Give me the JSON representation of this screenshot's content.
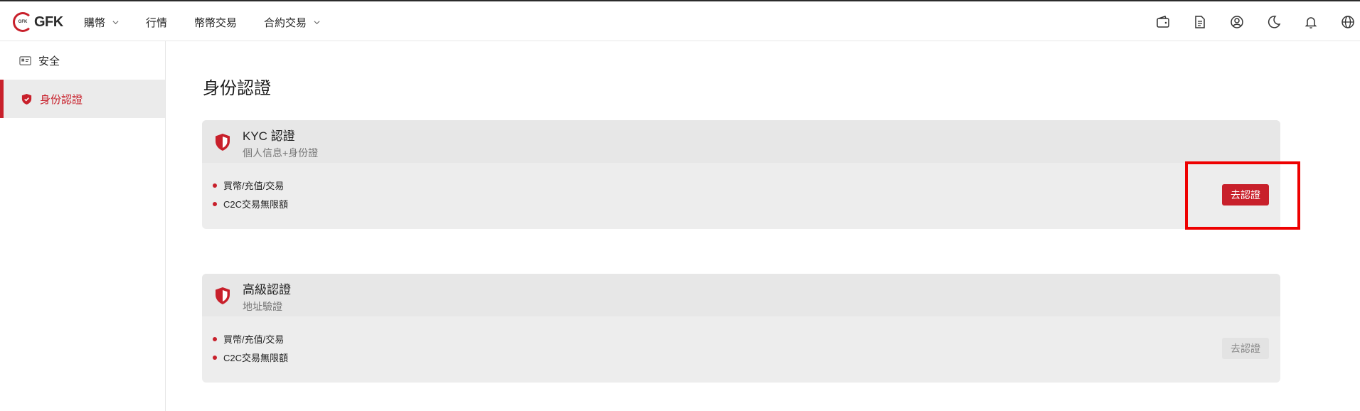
{
  "header": {
    "logo_text": "GFK",
    "logo_mark": "GFK",
    "nav": [
      {
        "label": "購幣",
        "has_dropdown": true
      },
      {
        "label": "行情",
        "has_dropdown": false
      },
      {
        "label": "幣幣交易",
        "has_dropdown": false
      },
      {
        "label": "合約交易",
        "has_dropdown": true
      }
    ],
    "tools": [
      "wallet-icon",
      "document-icon",
      "user-icon",
      "moon-icon",
      "bell-icon",
      "globe-icon"
    ]
  },
  "sidebar": {
    "items": [
      {
        "label": "安全",
        "icon": "id-card-icon",
        "active": false
      },
      {
        "label": "身份認證",
        "icon": "shield-check-icon",
        "active": true
      }
    ]
  },
  "main": {
    "title": "身份認證",
    "cards": [
      {
        "title": "KYC 認證",
        "subtitle": "個人信息+身份證",
        "features": [
          "買幣/充值/交易",
          "C2C交易無限額"
        ],
        "button_label": "去認證",
        "button_enabled": true
      },
      {
        "title": "高級認證",
        "subtitle": "地址驗證",
        "features": [
          "買幣/充值/交易",
          "C2C交易無限額"
        ],
        "button_label": "去認證",
        "button_enabled": false
      }
    ]
  },
  "colors": {
    "accent": "#c8202b",
    "highlight_box": "#ee0000"
  }
}
